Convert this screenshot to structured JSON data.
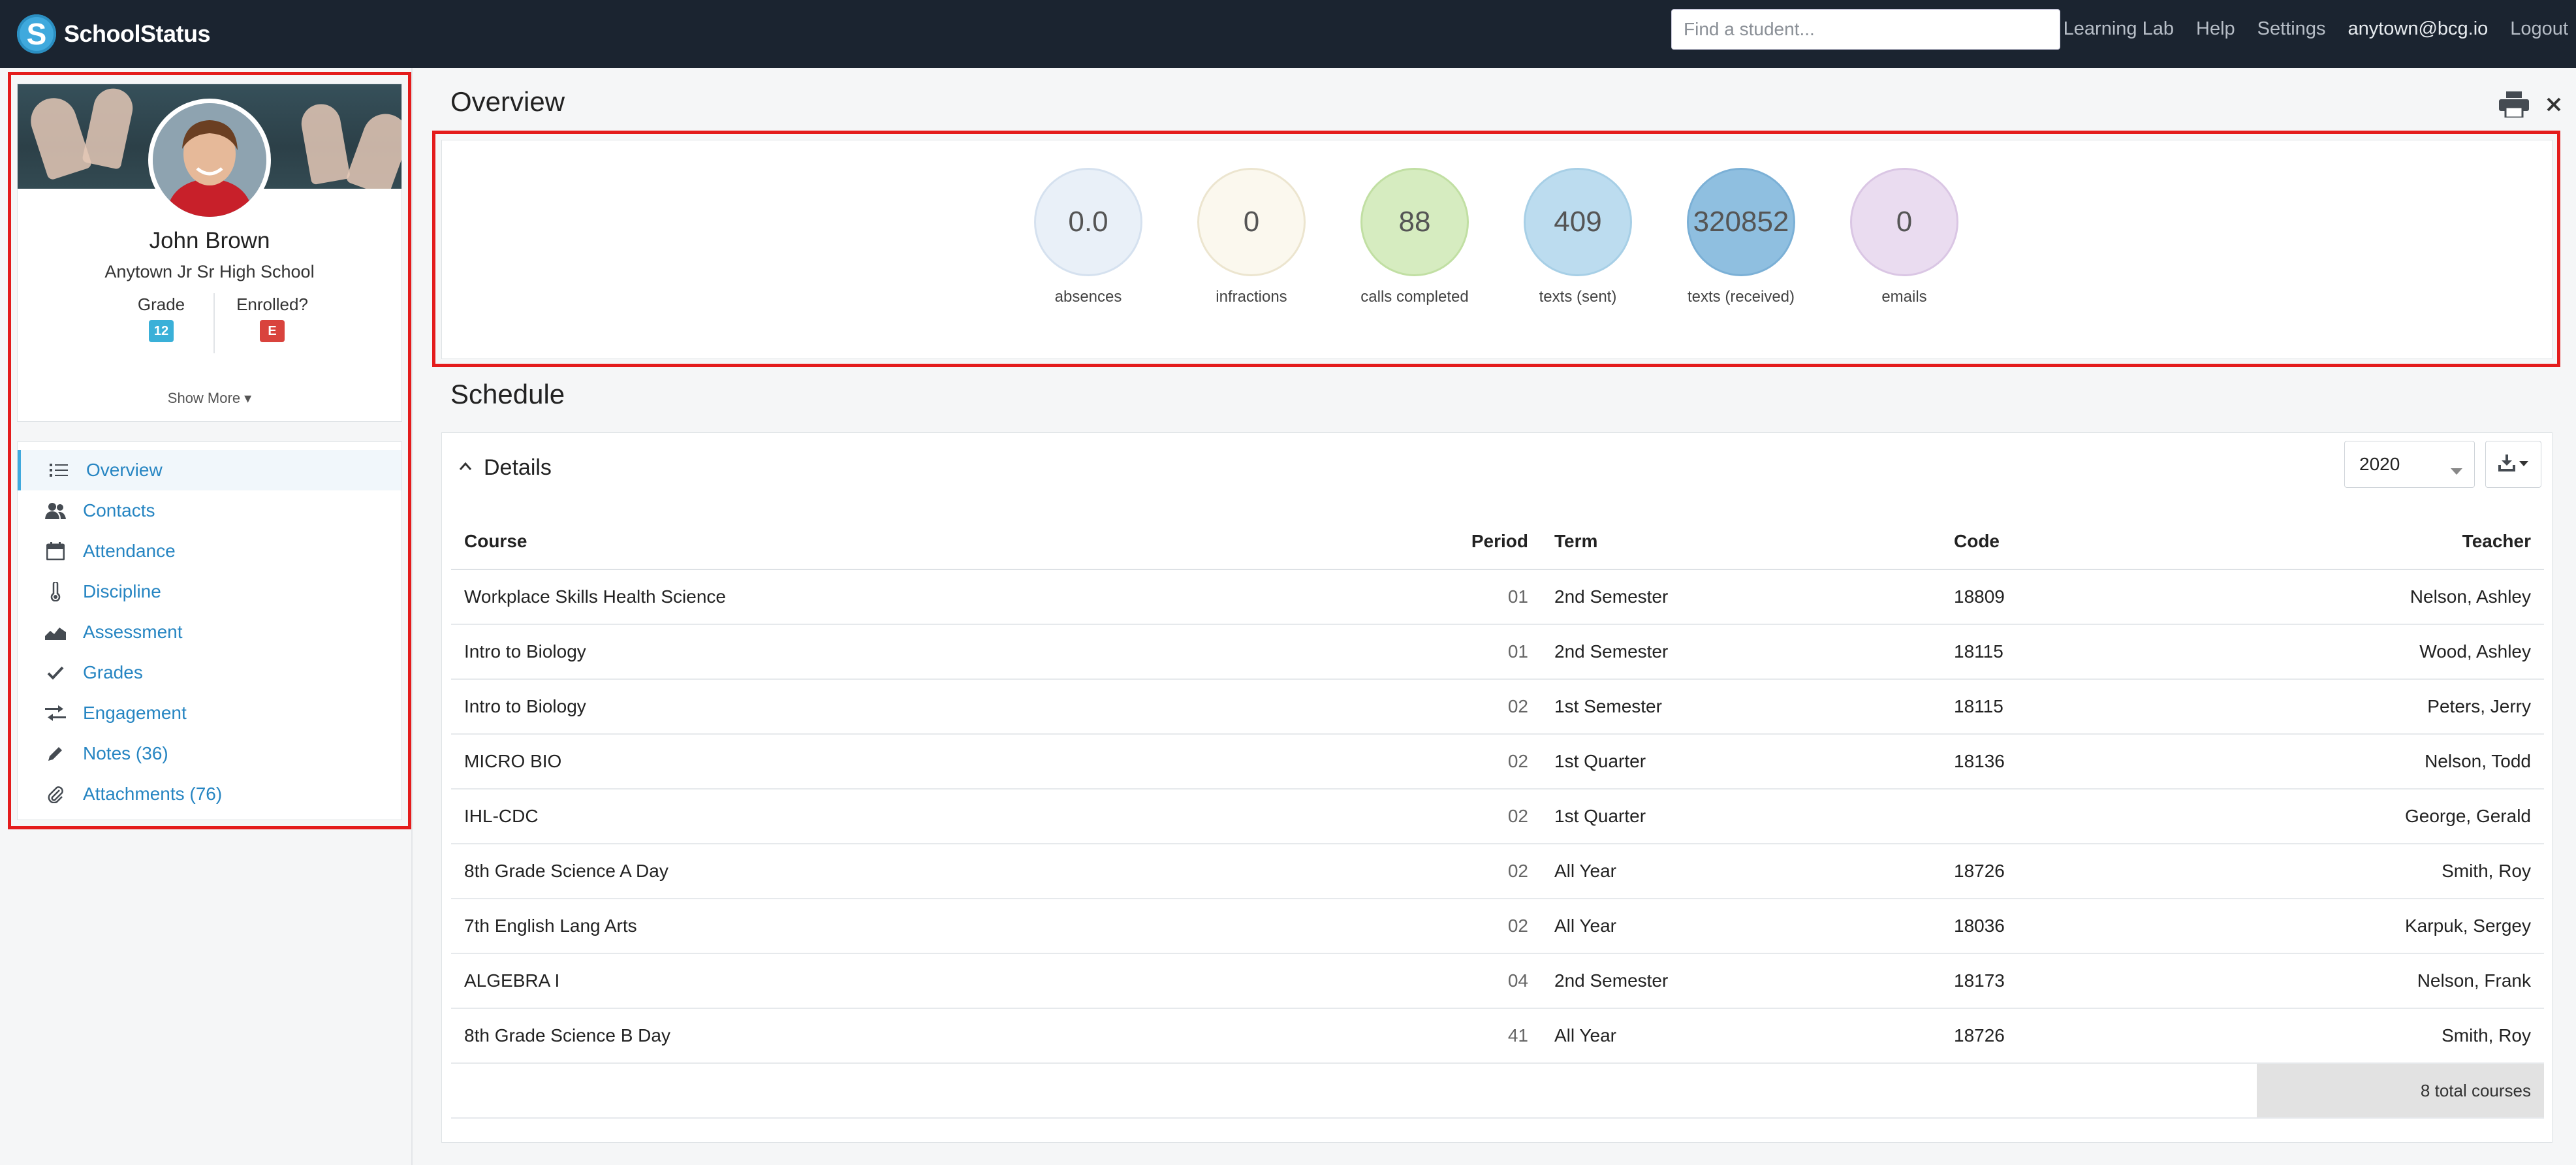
{
  "navbar": {
    "brand": "SchoolStatus",
    "search_placeholder": "Find a student...",
    "links": {
      "learning_lab": "Learning Lab",
      "help": "Help",
      "settings": "Settings",
      "user": "anytown@bcg.io",
      "logout": "Logout"
    }
  },
  "profile": {
    "name": "John Brown",
    "school": "Anytown Jr Sr High School",
    "grade_label": "Grade",
    "grade_value": "12",
    "enrolled_label": "Enrolled?",
    "enrolled_value": "E",
    "show_more": "Show More ▾"
  },
  "sidebar": {
    "items": [
      {
        "label": "Overview",
        "icon": "list-icon"
      },
      {
        "label": "Contacts",
        "icon": "contacts-icon"
      },
      {
        "label": "Attendance",
        "icon": "calendar-icon"
      },
      {
        "label": "Discipline",
        "icon": "thermometer-icon"
      },
      {
        "label": "Assessment",
        "icon": "area-chart-icon"
      },
      {
        "label": "Grades",
        "icon": "check-icon"
      },
      {
        "label": "Engagement",
        "icon": "exchange-icon"
      },
      {
        "label": "Notes (36)",
        "icon": "pencil-icon"
      },
      {
        "label": "Attachments (76)",
        "icon": "paperclip-icon"
      }
    ]
  },
  "overview": {
    "title": "Overview",
    "stats": [
      {
        "value": "0.0",
        "label": "absences",
        "fill": "#e9f0f8",
        "border": "#d5e1ef"
      },
      {
        "value": "0",
        "label": "infractions",
        "fill": "#fbf8ee",
        "border": "#ece5cf"
      },
      {
        "value": "88",
        "label": "calls completed",
        "fill": "#d6ecc0",
        "border": "#c1dfa3"
      },
      {
        "value": "409",
        "label": "texts (sent)",
        "fill": "#bcdcef",
        "border": "#a7cfe6"
      },
      {
        "value": "320852",
        "label": "texts (received)",
        "fill": "#8fbfe0",
        "border": "#7bb0d6"
      },
      {
        "value": "0",
        "label": "emails",
        "fill": "#eadcf0",
        "border": "#dac6e4"
      }
    ]
  },
  "schedule": {
    "title": "Schedule",
    "details_label": "Details",
    "year": "2020",
    "columns": {
      "course": "Course",
      "period": "Period",
      "term": "Term",
      "code": "Code",
      "teacher": "Teacher"
    },
    "rows": [
      {
        "course": "Workplace Skills Health Science",
        "period": "01",
        "term": "2nd Semester",
        "code": "18809",
        "teacher": "Nelson, Ashley"
      },
      {
        "course": "Intro to Biology",
        "period": "01",
        "term": "2nd Semester",
        "code": "18115",
        "teacher": "Wood, Ashley"
      },
      {
        "course": "Intro to Biology",
        "period": "02",
        "term": "1st Semester",
        "code": "18115",
        "teacher": "Peters, Jerry"
      },
      {
        "course": "MICRO BIO",
        "period": "02",
        "term": "1st Quarter",
        "code": "18136",
        "teacher": "Nelson, Todd"
      },
      {
        "course": "IHL-CDC",
        "period": "02",
        "term": "1st Quarter",
        "code": "",
        "teacher": "George, Gerald"
      },
      {
        "course": "8th Grade Science A Day",
        "period": "02",
        "term": "All Year",
        "code": "18726",
        "teacher": "Smith, Roy"
      },
      {
        "course": "7th English Lang Arts",
        "period": "02",
        "term": "All Year",
        "code": "18036",
        "teacher": "Karpuk, Sergey"
      },
      {
        "course": "ALGEBRA I",
        "period": "04",
        "term": "2nd Semester",
        "code": "18173",
        "teacher": "Nelson, Frank"
      },
      {
        "course": "8th Grade Science B Day",
        "period": "41",
        "term": "All Year",
        "code": "18726",
        "teacher": "Smith, Roy"
      }
    ],
    "total": "8 total courses"
  },
  "colors": {
    "navbar": "#1b2430",
    "link": "#2685c2",
    "highlight_box": "#e41c1c"
  }
}
